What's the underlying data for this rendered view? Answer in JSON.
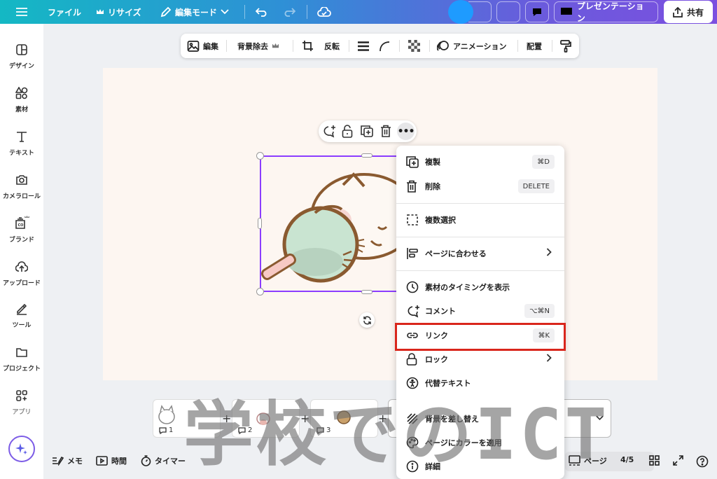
{
  "topbar": {
    "menu_icon": "hamburger-icon",
    "file_label": "ファイル",
    "resize_label": "リサイズ",
    "edit_mode_label": "編集モード",
    "presentation_label": "プレゼンテーション",
    "share_label": "共有"
  },
  "context_toolbar": {
    "edit_label": "編集",
    "bg_remove_label": "背景除去",
    "flip_label": "反転",
    "animation_label": "アニメーション",
    "position_label": "配置"
  },
  "sidebar": {
    "items": [
      {
        "label": "デザイン",
        "icon": "design-icon"
      },
      {
        "label": "素材",
        "icon": "elements-icon"
      },
      {
        "label": "テキスト",
        "icon": "text-icon"
      },
      {
        "label": "カメラロール",
        "icon": "camera-icon"
      },
      {
        "label": "ブランド",
        "icon": "brand-icon"
      },
      {
        "label": "アップロード",
        "icon": "upload-icon"
      },
      {
        "label": "ツール",
        "icon": "tool-icon"
      },
      {
        "label": "プロジェクト",
        "icon": "folder-icon"
      },
      {
        "label": "アプリ",
        "icon": "apps-icon"
      }
    ]
  },
  "context_menu": {
    "items": [
      {
        "label": "複製",
        "shortcut": "⌘D"
      },
      {
        "label": "削除",
        "shortcut": "DELETE"
      },
      {
        "label": "複数選択"
      },
      {
        "label": "ページに合わせる"
      },
      {
        "label": "素材のタイミングを表示"
      },
      {
        "label": "コメント",
        "shortcut": "⌥⌘N"
      },
      {
        "label": "リンク",
        "shortcut": "⌘K"
      },
      {
        "label": "ロック"
      },
      {
        "label": "代替テキスト"
      },
      {
        "label": "背景を差し替え"
      },
      {
        "label": "ページにカラーを適用"
      },
      {
        "label": "詳細"
      }
    ]
  },
  "pages": [
    {
      "number": "1"
    },
    {
      "number": "2"
    },
    {
      "number": "3"
    }
  ],
  "bottombar": {
    "memo_label": "メモ",
    "time_label": "時間",
    "timer_label": "タイマー",
    "pages_label": "ページ",
    "page_count": "4/5"
  },
  "watermark": "学校でのICT",
  "colors": {
    "highlight": "#d9261c",
    "selection": "#8b3dff",
    "avatar": "#1e9bff"
  }
}
